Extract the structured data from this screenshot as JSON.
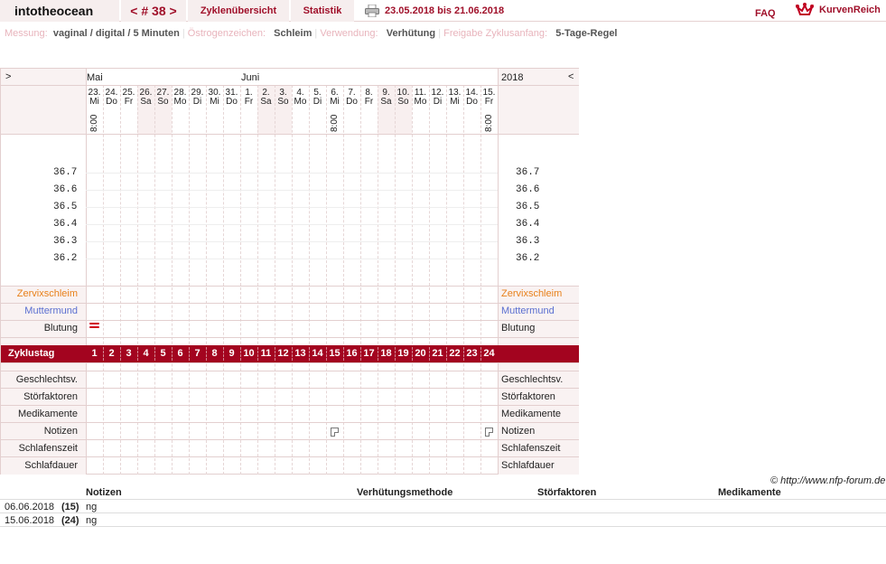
{
  "header": {
    "username": "intotheocean",
    "cycle_label": "< # 38 >",
    "tab_overview": "Zyklenübersicht",
    "tab_statistics": "Statistik",
    "date_range": "23.05.2018 bis 21.06.2018",
    "faq": "FAQ",
    "logo_text": "KurvenReich"
  },
  "info": {
    "messung_label": "Messung:",
    "messung_value": "vaginal / digital / 5 Minuten",
    "oestrogen_label": "Östrogenzeichen:",
    "oestrogen_value": "Schleim",
    "verwendung_label": "Verwendung:",
    "verwendung_value": "Verhütung",
    "freigabe_label": "Freigabe Zyklusanfang:",
    "freigabe_value": "5-Tage-Regel"
  },
  "chart": {
    "nav_left": ">",
    "nav_right": "<",
    "year": "2018",
    "months": [
      {
        "label": "Mai",
        "day_index": 0
      },
      {
        "label": "Juni",
        "day_index": 9
      }
    ],
    "days": [
      {
        "num": "23.",
        "wd": "Mi",
        "weekend": false,
        "time": "8:00"
      },
      {
        "num": "24.",
        "wd": "Do",
        "weekend": false,
        "time": ""
      },
      {
        "num": "25.",
        "wd": "Fr",
        "weekend": false,
        "time": ""
      },
      {
        "num": "26.",
        "wd": "Sa",
        "weekend": true,
        "time": ""
      },
      {
        "num": "27.",
        "wd": "So",
        "weekend": true,
        "time": ""
      },
      {
        "num": "28.",
        "wd": "Mo",
        "weekend": false,
        "time": ""
      },
      {
        "num": "29.",
        "wd": "Di",
        "weekend": false,
        "time": ""
      },
      {
        "num": "30.",
        "wd": "Mi",
        "weekend": false,
        "time": ""
      },
      {
        "num": "31.",
        "wd": "Do",
        "weekend": false,
        "time": ""
      },
      {
        "num": "1.",
        "wd": "Fr",
        "weekend": false,
        "time": ""
      },
      {
        "num": "2.",
        "wd": "Sa",
        "weekend": true,
        "time": ""
      },
      {
        "num": "3.",
        "wd": "So",
        "weekend": true,
        "time": ""
      },
      {
        "num": "4.",
        "wd": "Mo",
        "weekend": false,
        "time": ""
      },
      {
        "num": "5.",
        "wd": "Di",
        "weekend": false,
        "time": ""
      },
      {
        "num": "6.",
        "wd": "Mi",
        "weekend": false,
        "time": "8:00"
      },
      {
        "num": "7.",
        "wd": "Do",
        "weekend": false,
        "time": ""
      },
      {
        "num": "8.",
        "wd": "Fr",
        "weekend": false,
        "time": ""
      },
      {
        "num": "9.",
        "wd": "Sa",
        "weekend": true,
        "time": ""
      },
      {
        "num": "10.",
        "wd": "So",
        "weekend": true,
        "time": ""
      },
      {
        "num": "11.",
        "wd": "Mo",
        "weekend": false,
        "time": ""
      },
      {
        "num": "12.",
        "wd": "Di",
        "weekend": false,
        "time": ""
      },
      {
        "num": "13.",
        "wd": "Mi",
        "weekend": false,
        "time": ""
      },
      {
        "num": "14.",
        "wd": "Do",
        "weekend": false,
        "time": ""
      },
      {
        "num": "15.",
        "wd": "Fr",
        "weekend": false,
        "time": "8:00"
      }
    ],
    "temperatures": [
      "36.7",
      "36.6",
      "36.5",
      "36.4",
      "36.3",
      "36.2"
    ],
    "rows_upper": [
      "Zervixschleim",
      "Muttermund",
      "Blutung"
    ],
    "cycle_row_label": "Zyklustag",
    "cycle_days": [
      "1",
      "2",
      "3",
      "4",
      "5",
      "6",
      "7",
      "8",
      "9",
      "10",
      "11",
      "12",
      "13",
      "14",
      "15",
      "16",
      "17",
      "18",
      "19",
      "20",
      "21",
      "22",
      "23",
      "24"
    ],
    "rows_lower": [
      "Geschlechtsv.",
      "Störfaktoren",
      "Medikamente",
      "Notizen",
      "Schlafenszeit",
      "Schlafdauer"
    ],
    "bleeding_days": [
      0
    ],
    "note_days": [
      14,
      23
    ],
    "colors": {
      "cycle_bar": "#a3041f",
      "zervix": "#e8801a",
      "muttermund": "#5a6fd0",
      "weekend": "#f8efef",
      "accent": "#a0102a"
    }
  },
  "footer": {
    "copyright": "© http://www.nfp-forum.de",
    "columns": [
      "Notizen",
      "Verhütungsmethode",
      "Störfaktoren",
      "Medikamente"
    ],
    "rows": [
      {
        "date": "06.06.2018",
        "day": "(15)",
        "note": "ng"
      },
      {
        "date": "15.06.2018",
        "day": "(24)",
        "note": "ng"
      }
    ]
  }
}
